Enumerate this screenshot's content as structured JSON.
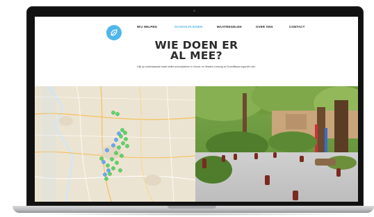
{
  "nav": {
    "items": [
      {
        "label": "WIJ HELPEN",
        "active": false
      },
      {
        "label": "SCHOOLPLEINEN",
        "active": true
      },
      {
        "label": "MAATREGELEN",
        "active": false
      },
      {
        "label": "OVER ONS",
        "active": false
      },
      {
        "label": "CONTACT",
        "active": false
      }
    ]
  },
  "hero": {
    "title_line1": "WIE DOEN ER",
    "title_line2": "AL MEE?",
    "subtitle": "Kijk op onderstaande kaart welke schoolpleinen in Noord- en Midden-Limburg al GroenBlauw ingericht zijn."
  },
  "colors": {
    "accent": "#4fb6ea",
    "marker_green": "#5fd36a",
    "marker_blue": "#6aa9f2",
    "title": "#2b2b2b"
  },
  "icons": {
    "logo": "leaf-logo-icon"
  }
}
